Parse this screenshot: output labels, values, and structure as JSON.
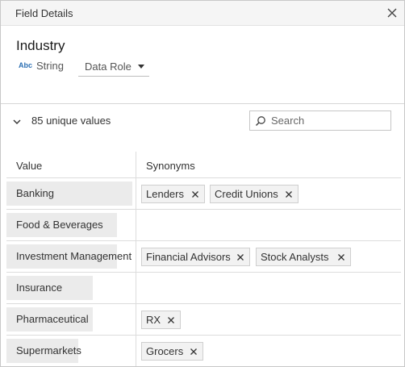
{
  "dialog": {
    "title": "Field Details"
  },
  "field": {
    "name": "Industry",
    "type_abbrev": "Abc",
    "type_label": "String",
    "data_role_label": "Data Role"
  },
  "values_section": {
    "unique_count": "85 unique values",
    "search_placeholder": "Search"
  },
  "table": {
    "headers": {
      "value": "Value",
      "synonyms": "Synonyms"
    },
    "rows": [
      {
        "value": "Banking",
        "synonyms": [
          "Lenders",
          "Credit Unions"
        ]
      },
      {
        "value": "Food & Beverages",
        "synonyms": []
      },
      {
        "value": "Investment Management",
        "synonyms": [
          "Financial Advisors",
          "Stock Analysts"
        ]
      },
      {
        "value": "Insurance",
        "synonyms": []
      },
      {
        "value": "Pharmaceutical",
        "synonyms": [
          "RX"
        ]
      },
      {
        "value": "Supermarkets",
        "synonyms": [
          "Grocers"
        ]
      }
    ]
  },
  "colors": {
    "titlebar_bg": "#f5f5f5",
    "value_cell_bg": "#ebebeb",
    "chip_bg": "#f2f2f2",
    "type_icon": "#2b6fb3"
  },
  "icons": {
    "close": "close-icon",
    "collapse": "chevron-down-icon",
    "search": "search-icon",
    "remove_synonym": "remove-icon",
    "dropdown": "caret-down-icon"
  }
}
